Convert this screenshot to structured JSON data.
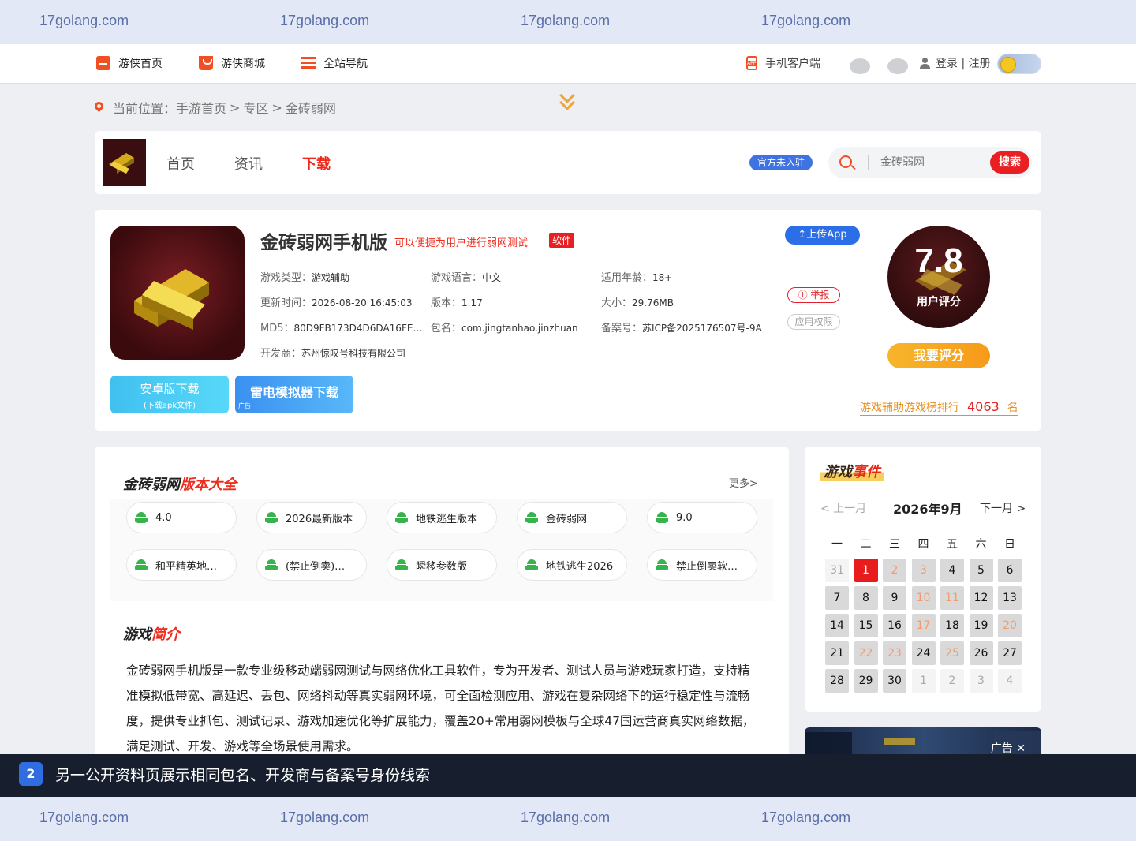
{
  "watermark": {
    "text": "17golang.com"
  },
  "topnav": {
    "items": [
      {
        "label": "游侠首页",
        "icon": "home-icon"
      },
      {
        "label": "游侠商城",
        "icon": "shop-icon"
      },
      {
        "label": "全站导航",
        "icon": "list-icon"
      }
    ],
    "mobile_client": "手机客户端",
    "login": "登录 | 注册"
  },
  "breadcrumb": {
    "prefix": "当前位置：",
    "items": [
      "手游首页",
      "专区",
      "金砖弱网"
    ],
    "separator": ">"
  },
  "header_bar": {
    "tabs": [
      "首页",
      "资讯",
      "下载"
    ],
    "active_tab": "下载",
    "official_label": "官方未入驻",
    "search_placeholder": "金砖弱网",
    "search_button": "搜索"
  },
  "app": {
    "title": "金砖弱网手机版",
    "tagline": "可以便捷为用户进行弱网测试",
    "badge": "软件",
    "meta": {
      "type_label": "游戏类型：",
      "type": "游戏辅助",
      "lang_label": "游戏语言：",
      "lang": "中文",
      "age_label": "适用年龄：",
      "age": "18+",
      "update_label": "更新时间：",
      "update": "2026-08-20 16:45:03",
      "version_label": "版本：",
      "version": "1.17",
      "size_label": "大小：",
      "size": "29.76MB",
      "md5_label": "MD5：",
      "md5": "80D9FB173D4D6DA16FEF…",
      "pkg_label": "包名：",
      "pkg": "com.jingtanhao.jinzhuan",
      "icp_label": "备案号：",
      "icp": "苏ICP备2025176507号-9A",
      "dev_label": "开发商：",
      "dev": "苏州惊叹号科技有限公司"
    },
    "upload_button": "上传App",
    "report_button": "举报",
    "permissions_button": "应用权限",
    "score": "7.8",
    "score_label": "用户评分",
    "rate_button": "我要评分",
    "rank_prefix": "游戏辅助游戏榜排行",
    "rank_value": "4063",
    "rank_suffix": "名",
    "download_android": "安卓版下载",
    "download_android_sub": "(下载apk文件)",
    "download_ld": "雷电模拟器下载",
    "ad_tag": "广告"
  },
  "versions": {
    "title_black": "金砖弱网",
    "title_red": "版本大全",
    "more": "更多>",
    "items": [
      "4.0",
      "2026最新版本",
      "地铁逃生版本",
      "金砖弱网",
      "9.0",
      "和平精英地…",
      "(禁止倒卖)…",
      "瞬移参数版",
      "地铁逃生2026",
      "禁止倒卖软…"
    ]
  },
  "intro": {
    "title_black": "游戏",
    "title_red": "简介",
    "text": "金砖弱网手机版是一款专业级移动端弱网测试与网络优化工具软件，专为开发者、测试人员与游戏玩家打造，支持精准模拟低带宽、高延迟、丢包、网络抖动等真实弱网环境，可全面检测应用、游戏在复杂网络下的运行稳定性与流畅度，提供专业抓包、测试记录、游戏加速优化等扩展能力，覆盖20+常用弱网模板与全球47国运营商真实网络数据，满足测试、开发、游戏等全场景使用需求。"
  },
  "events": {
    "title_dark": "游戏",
    "title_red": "事件",
    "prev": "<  上一月",
    "month": "2026年9月",
    "next": "下一月  >",
    "weekdays": [
      "一",
      "二",
      "三",
      "四",
      "五",
      "六",
      "日"
    ],
    "days": [
      {
        "d": "31",
        "k": "other"
      },
      {
        "d": "1",
        "k": "today"
      },
      {
        "d": "2",
        "k": "wkend"
      },
      {
        "d": "3",
        "k": "wkend"
      },
      {
        "d": "4",
        "k": "cur"
      },
      {
        "d": "5",
        "k": "cur"
      },
      {
        "d": "6",
        "k": "cur"
      },
      {
        "d": "7",
        "k": "cur"
      },
      {
        "d": "8",
        "k": "cur"
      },
      {
        "d": "9",
        "k": "cur"
      },
      {
        "d": "10",
        "k": "wkend"
      },
      {
        "d": "11",
        "k": "wkend"
      },
      {
        "d": "12",
        "k": "cur"
      },
      {
        "d": "13",
        "k": "cur"
      },
      {
        "d": "14",
        "k": "cur"
      },
      {
        "d": "15",
        "k": "cur"
      },
      {
        "d": "16",
        "k": "cur"
      },
      {
        "d": "17",
        "k": "wkend"
      },
      {
        "d": "18",
        "k": "cur"
      },
      {
        "d": "19",
        "k": "cur"
      },
      {
        "d": "20",
        "k": "wkend"
      },
      {
        "d": "21",
        "k": "cur"
      },
      {
        "d": "22",
        "k": "wkend"
      },
      {
        "d": "23",
        "k": "wkend"
      },
      {
        "d": "24",
        "k": "cur"
      },
      {
        "d": "25",
        "k": "wkend"
      },
      {
        "d": "26",
        "k": "cur"
      },
      {
        "d": "27",
        "k": "cur"
      },
      {
        "d": "28",
        "k": "cur"
      },
      {
        "d": "29",
        "k": "cur"
      },
      {
        "d": "30",
        "k": "cur"
      },
      {
        "d": "1",
        "k": "other"
      },
      {
        "d": "2",
        "k": "other"
      },
      {
        "d": "3",
        "k": "other"
      },
      {
        "d": "4",
        "k": "other"
      }
    ]
  },
  "ad_strip": {
    "label": "广告 ✕"
  },
  "notice": {
    "number": "2",
    "text": "另一公开资料页展示相同包名、开发商与备案号身份线索"
  },
  "colors": {
    "accent": "#f02c1d",
    "brand_blue": "#2c6ee8",
    "gold": "#f7b52c"
  }
}
